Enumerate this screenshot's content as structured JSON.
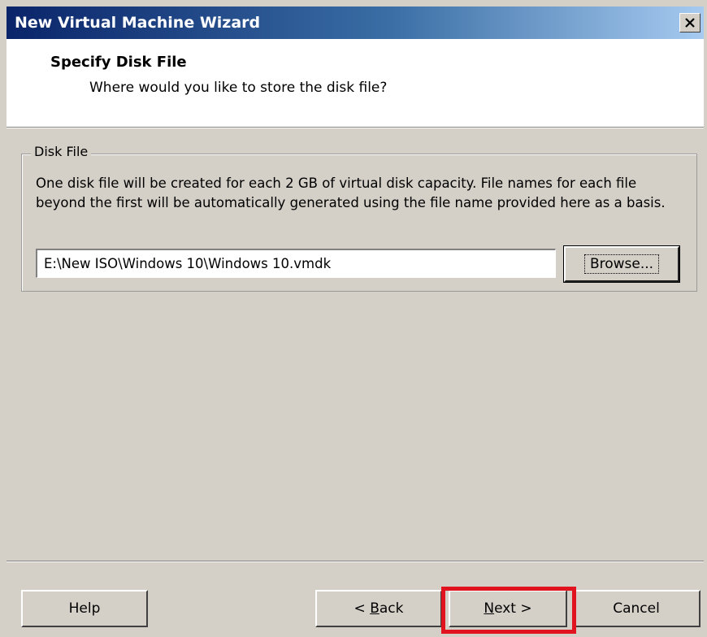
{
  "window": {
    "title": "New Virtual Machine Wizard",
    "close_symbol": "×"
  },
  "header": {
    "title": "Specify Disk File",
    "subtitle": "Where would you like to store the disk file?"
  },
  "disk_file_group": {
    "legend": "Disk File",
    "description": "One disk file will be created for each 2 GB of virtual disk capacity. File names for each file beyond the first will be automatically generated using the file name provided here as a basis.",
    "path_value": "E:\\New ISO\\Windows 10\\Windows 10.vmdk",
    "browse_label": "Browse..."
  },
  "footer": {
    "help_label": "Help",
    "back_prefix": "< ",
    "back_mnemonic": "B",
    "back_rest": "ack",
    "next_mnemonic": "N",
    "next_rest": "ext >",
    "cancel_label": "Cancel"
  },
  "colors": {
    "titlebar_start": "#0a246a",
    "titlebar_end": "#a6caf0",
    "dialog_face": "#d4d0c8",
    "highlight": "#e0131f"
  },
  "icons": {
    "close": "close-icon"
  }
}
